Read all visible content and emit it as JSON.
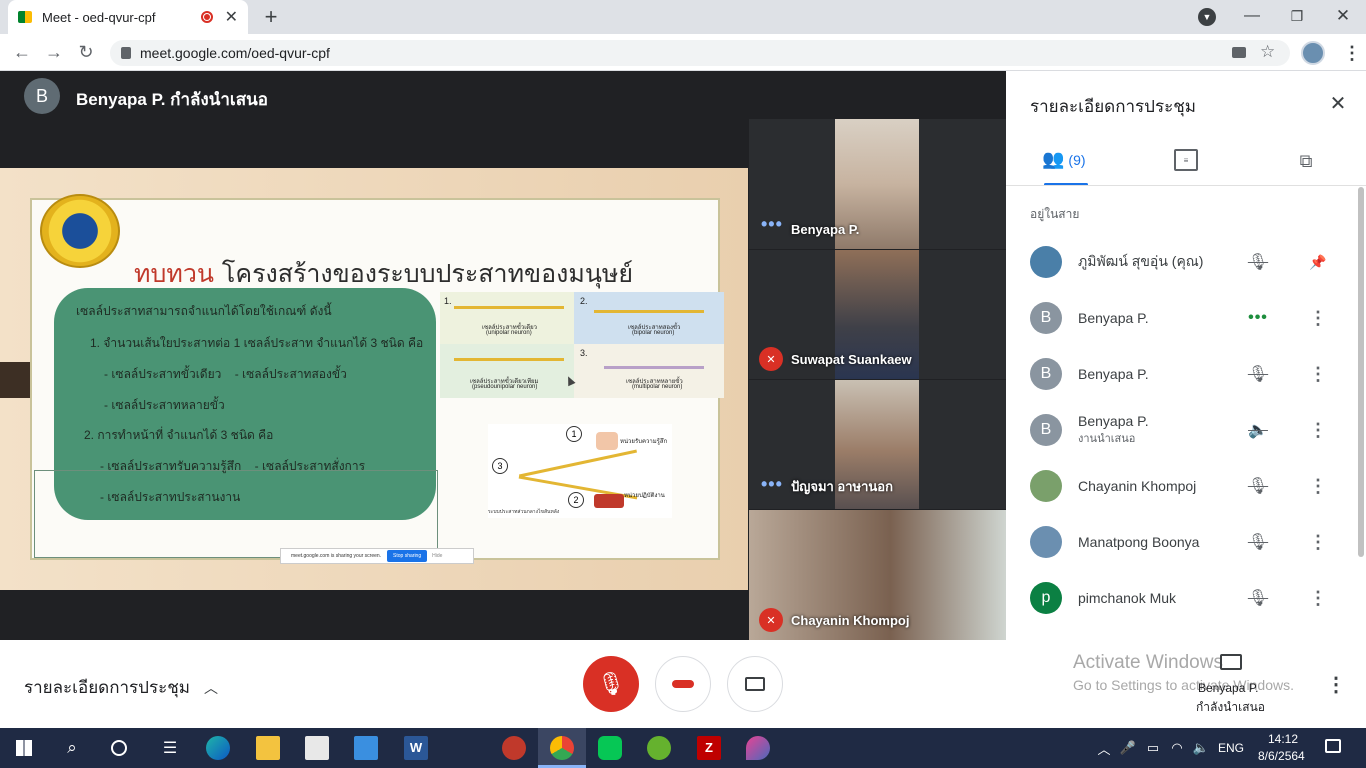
{
  "browser": {
    "tab_title": "Meet - oed-qvur-cpf",
    "url": "meet.google.com/oed-qvur-cpf"
  },
  "presenter": {
    "initial": "B",
    "banner": "Benyapa P. กำลังนำเสนอ"
  },
  "slide": {
    "title_accent": "ทบทวน",
    "title_main": "โครงสร้างของระบบประสาทของมนุษย์",
    "lines": [
      "เซลล์ประสาทสามารถจำแนกได้โดยใช้เกณฑ์ ดังนี้",
      "1. จำนวนเส้นใยประสาทต่อ 1 เซลล์ประสาท จำแนกได้ 3 ชนิด คือ",
      "- เซลล์ประสาทขั้วเดียว    - เซลล์ประสาทสองขั้ว",
      "- เซลล์ประสาทหลายขั้ว",
      "2. การทำหน้าที่ จำแนกได้ 3 ชนิด คือ",
      "- เซลล์ประสาทรับความรู้สึก    - เซลล์ประสาทสั่งการ",
      "- เซลล์ประสาทประสานงาน"
    ],
    "neurons": [
      {
        "num": "1.",
        "label": "เซลล์ประสาทขั้วเดียว",
        "en": "(unipolar neuron)"
      },
      {
        "num": "2.",
        "label": "เซลล์ประสาทสองขั้ว",
        "en": "(bipolar neuron)"
      },
      {
        "num": "",
        "label": "เซลล์ประสาทขั้วเดียวเทียม",
        "en": "(pseudounipolar neuron)"
      },
      {
        "num": "3.",
        "label": "เซลล์ประสาทหลายขั้ว",
        "en": "(multipolar neuron)"
      }
    ],
    "reflex": {
      "n1": "1",
      "n2": "2",
      "n3": "3",
      "receptor": "หน่วยรับความรู้สึก",
      "effector": "หน่วยปฏิบัติงาน",
      "caption": "ระบบประสาทส่วนกลางไขสันหลัง"
    },
    "sharing_bar": {
      "text": "meet.google.com is sharing your screen.",
      "stop": "Stop sharing",
      "hide": "Hide"
    }
  },
  "tiles": [
    {
      "name": "Benyapa P.",
      "state": "speaking"
    },
    {
      "name": "Suwapat Suankaew",
      "state": "muted"
    },
    {
      "name": "ปัญจมา อาษานอก",
      "state": "speaking"
    },
    {
      "name": "Chayanin Khompoj",
      "state": "muted"
    }
  ],
  "panel": {
    "title": "รายละเอียดการประชุม",
    "people_count": "(9)",
    "section": "อยู่ในสาย",
    "participants": [
      {
        "name": "ภูมิพัฒน์ สุขอุ่น (คุณ)",
        "sub": "",
        "initial": "",
        "color": "#4a7fa8",
        "status": "mic-off",
        "action": "pin"
      },
      {
        "name": "Benyapa P.",
        "sub": "",
        "initial": "B",
        "color": "#8a95a0",
        "status": "speaking",
        "action": "more"
      },
      {
        "name": "Benyapa P.",
        "sub": "",
        "initial": "B",
        "color": "#8a95a0",
        "status": "mic-off",
        "action": "more"
      },
      {
        "name": "Benyapa P.",
        "sub": "งานนำเสนอ",
        "initial": "B",
        "color": "#8a95a0",
        "status": "sound-off",
        "action": "more"
      },
      {
        "name": "Chayanin Khompoj",
        "sub": "",
        "initial": "",
        "color": "#7aa06b",
        "status": "mic-off",
        "action": "more"
      },
      {
        "name": "Manatpong Boonya",
        "sub": "",
        "initial": "",
        "color": "#6b8fb0",
        "status": "mic-off",
        "action": "more"
      },
      {
        "name": "pimchanok Muk",
        "sub": "",
        "initial": "p",
        "color": "#0b8043",
        "status": "mic-off",
        "action": "more"
      }
    ]
  },
  "bottom": {
    "meeting_details": "รายละเอียดการประชุม",
    "watermark_title": "Activate Windows",
    "watermark_sub": "Go to Settings to activate Windows.",
    "presenting_name": "Benyapa P.",
    "presenting_label": "กำลังนำเสนอ"
  },
  "taskbar": {
    "time": "14:12",
    "date": "8/6/2564",
    "lang": "ENG"
  },
  "colors": {
    "end_call": "#d93025",
    "accent": "#1a73e8",
    "slide_green": "#4a9474",
    "title_red": "#c0392b"
  }
}
